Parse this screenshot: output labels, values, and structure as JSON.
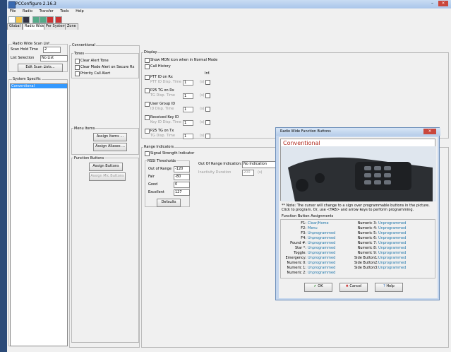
{
  "app": {
    "title": "PCConfigure 2.16.3"
  },
  "menu": [
    "File",
    "Radio",
    "Transfer",
    "Tools",
    "Help"
  ],
  "tabs": [
    "Global",
    "Radio Wide",
    "Per System",
    "Zone"
  ],
  "scan": {
    "group_label": "Radio Wide Scan List",
    "hold_time_label": "Scan Hold Time",
    "hold_time_value": "2",
    "list_selection_label": "List Selection",
    "list_selection_value": "No List",
    "edit_button": "Edit Scan Lists..."
  },
  "system_specific": {
    "label": "System Specific",
    "items": [
      "Conventional"
    ]
  },
  "conventional": {
    "label": "Conventional",
    "tones_label": "Tones",
    "tones": [
      "Clear Alert Tone",
      "Clear Mode Alert on Secure Rx",
      "Priority Call Alert"
    ],
    "display_label": "Display",
    "display_opts": [
      "Show MON icon when in Normal Mode",
      "Call History"
    ],
    "ptt": {
      "label": "PTT ID on Rx",
      "sub": "PTT ID Disp. Time",
      "value": "1",
      "unit": "(s)"
    },
    "p25tg": {
      "label": "P25 TG on Rx",
      "sub": "TG Disp. Time",
      "value": "1",
      "unit": "(s)"
    },
    "usergrp": {
      "label": "User Group ID",
      "sub": "ID Disp. Time",
      "value": "1",
      "unit": "(s)"
    },
    "recvkey": {
      "label": "Received Key ID",
      "sub": "Key ID Disp. Time",
      "value": "1",
      "unit": "(s)"
    },
    "p25tx": {
      "label": "P25 TG on Tx",
      "sub": "TG Disp. Time",
      "value": "1",
      "unit": "(s)"
    },
    "inf_label": "Inf.",
    "menu_items_label": "Menu Items",
    "assign_items": "Assign Items ...",
    "assign_aliases": "Assign Aliases ...",
    "function_buttons_label": "Function Buttons",
    "assign_buttons": "Assign Buttons",
    "assign_mic": "Assign Mic Buttons"
  },
  "range": {
    "label": "Range Indicators",
    "signal": "Signal Strength Indicator",
    "rssi_label": "RSSI Thresholds",
    "rows": [
      {
        "name": "Out of Range",
        "value": "-120"
      },
      {
        "name": "Fair",
        "value": "-80"
      },
      {
        "name": "Good",
        "value": "0"
      },
      {
        "name": "Excellent",
        "value": "127"
      }
    ],
    "defaults": "Defaults",
    "ood_label": "Out Of Range Indication:",
    "ood_value": "No Indication",
    "inactivity_label": "Inactivity Duration",
    "inactivity_value": "200",
    "inactivity_unit": "(s)"
  },
  "dialog": {
    "title": "Radio Wide Function Buttons",
    "heading": "Conventional",
    "note": "** Note: The cursor will change to a    sign over programmable buttons in the picture. Click to program. Or, use <TAB> and arrow keys to perform programming.",
    "assignments_label": "Function Button Assignments",
    "left": [
      {
        "k": "F1:",
        "v": "Clear/Home"
      },
      {
        "k": "F2:",
        "v": "Menu"
      },
      {
        "k": "F3:",
        "v": "Unprogrammed"
      },
      {
        "k": "F4:",
        "v": "Unprogrammed"
      },
      {
        "k": "Pound #:",
        "v": "Unprogrammed"
      },
      {
        "k": "Star *:",
        "v": "Unprogrammed"
      },
      {
        "k": "Toggle:",
        "v": "Unprogrammed"
      },
      {
        "k": "Emergency:",
        "v": "Unprogrammed"
      },
      {
        "k": "Numeric 0:",
        "v": "Unprogrammed"
      },
      {
        "k": "Numeric 1:",
        "v": "Unprogrammed"
      },
      {
        "k": "Numeric 2:",
        "v": "Unprogrammed"
      }
    ],
    "right": [
      {
        "k": "Numeric 3:",
        "v": "Unprogrammed"
      },
      {
        "k": "Numeric 4:",
        "v": "Unprogrammed"
      },
      {
        "k": "Numeric 5:",
        "v": "Unprogrammed"
      },
      {
        "k": "Numeric 6:",
        "v": "Unprogrammed"
      },
      {
        "k": "Numeric 7:",
        "v": "Unprogrammed"
      },
      {
        "k": "Numeric 8:",
        "v": "Unprogrammed"
      },
      {
        "k": "Numeric 9:",
        "v": "Unprogrammed"
      },
      {
        "k": "Side Button1:",
        "v": "Unprogrammed"
      },
      {
        "k": "Side Button2:",
        "v": "Unprogrammed"
      },
      {
        "k": "Side Button3:",
        "v": "Unprogrammed"
      }
    ],
    "ok": "OK",
    "cancel": "Cancel",
    "help": "Help"
  }
}
